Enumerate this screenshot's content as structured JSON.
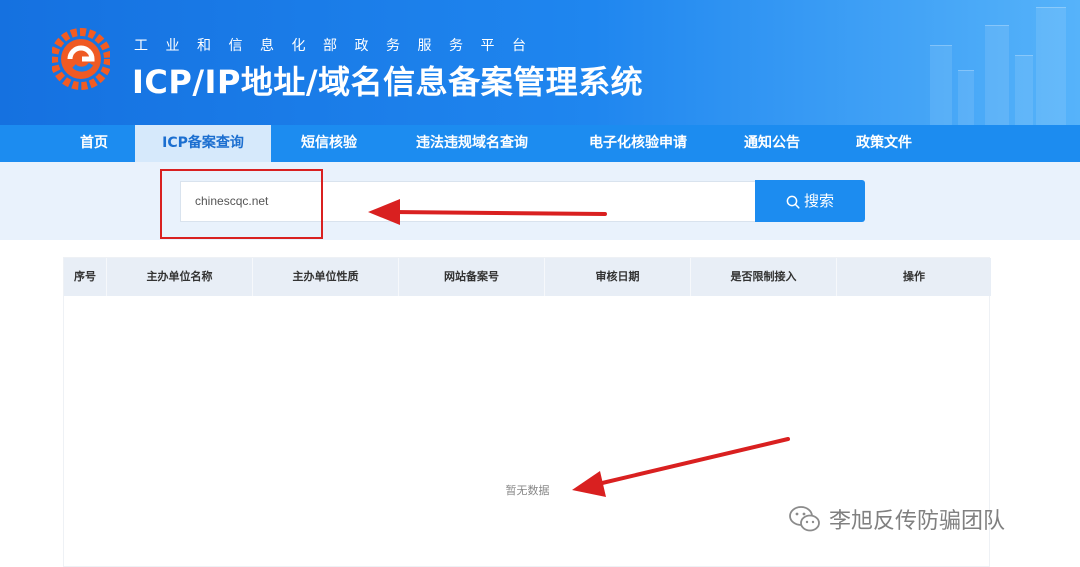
{
  "header": {
    "subtitle": "工业和信息化部政务服务平台",
    "title": "ICP/IP地址/域名信息备案管理系统"
  },
  "nav": {
    "items": [
      {
        "label": "首页"
      },
      {
        "label": "ICP备案查询",
        "active": true
      },
      {
        "label": "短信核验"
      },
      {
        "label": "违法违规域名查询"
      },
      {
        "label": "电子化核验申请"
      },
      {
        "label": "通知公告"
      },
      {
        "label": "政策文件"
      }
    ]
  },
  "search": {
    "value": "chinescqc.net",
    "button_label": "搜索",
    "button_icon": "search-icon"
  },
  "table": {
    "columns": [
      "序号",
      "主办单位名称",
      "主办单位性质",
      "网站备案号",
      "审核日期",
      "是否限制接入",
      "操作"
    ],
    "empty_text": "暂无数据"
  },
  "watermark": {
    "icon": "wechat-icon",
    "text": "李旭反传防骗团队"
  },
  "colors": {
    "header_blue": "#1571e0",
    "nav_blue": "#1c8cf0",
    "annotation_red": "#d92020"
  }
}
